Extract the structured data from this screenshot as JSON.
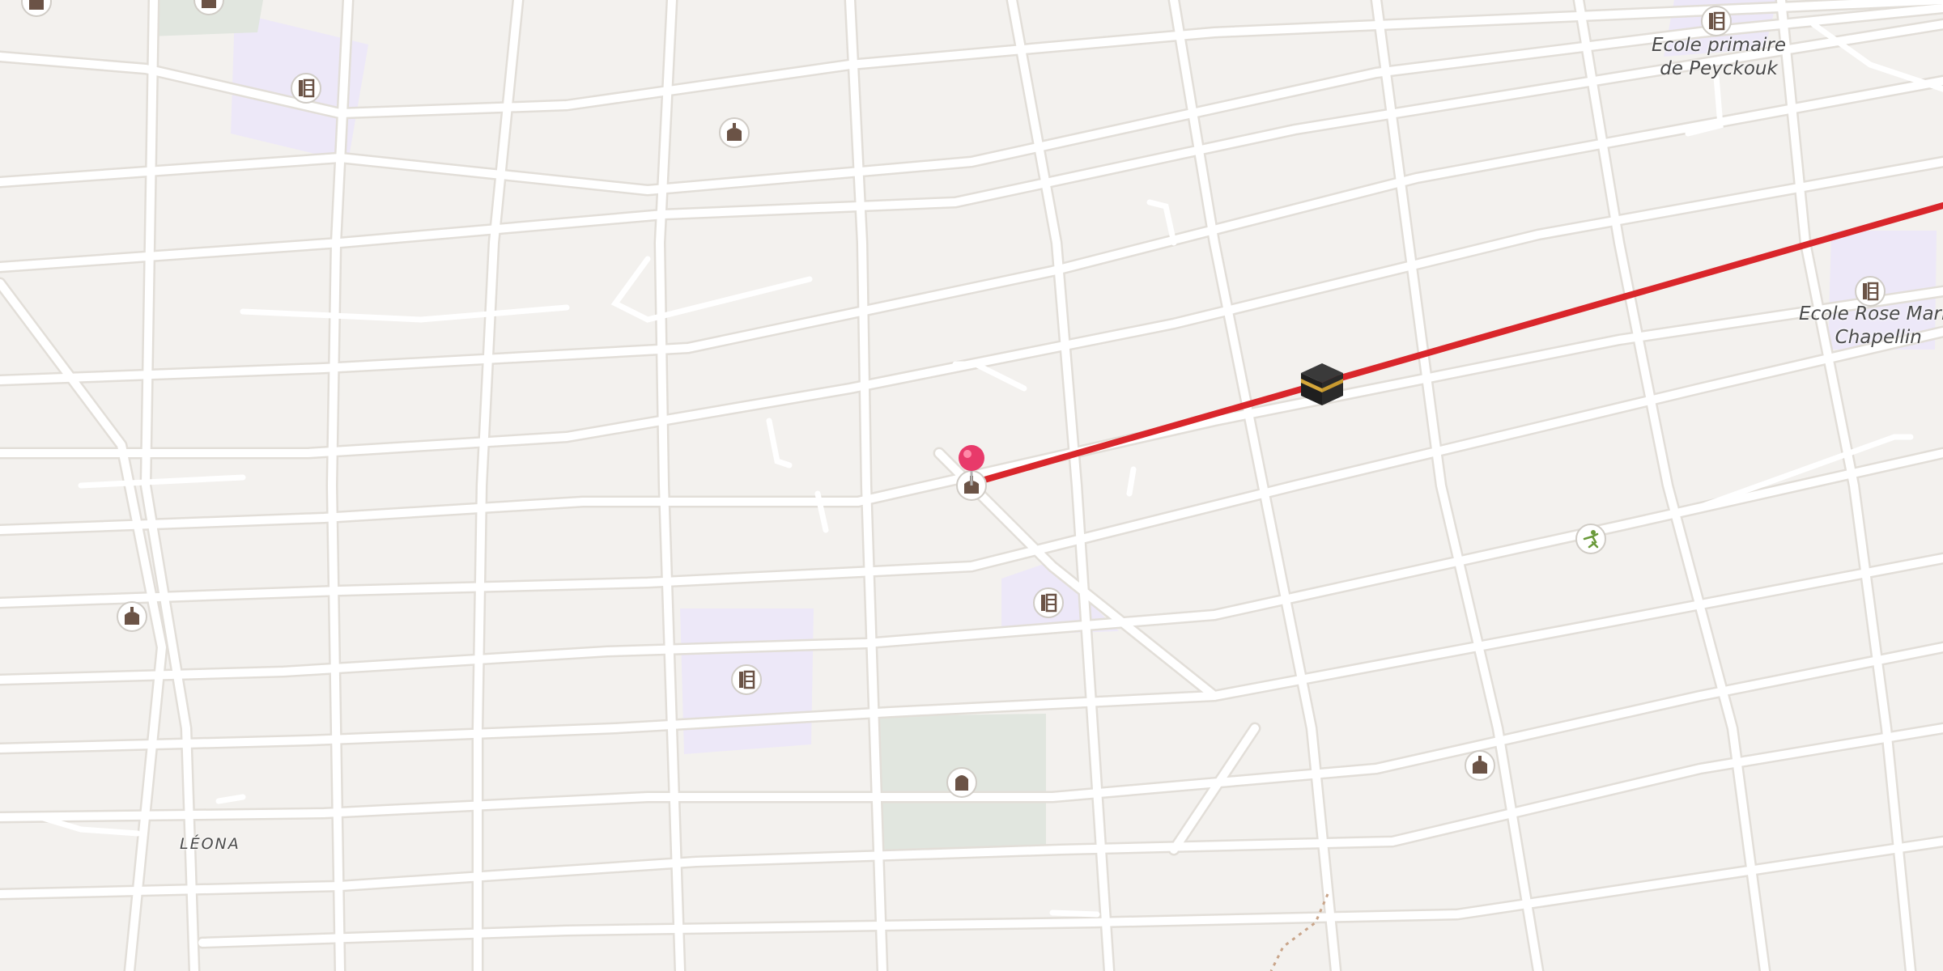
{
  "map": {
    "labels": {
      "school_peyckouk": {
        "line1": "Ecole primaire",
        "line2": "de Peyckouk"
      },
      "school_rose_marie": {
        "line1": "Ecole Rose Marie",
        "line2": "Chapellin"
      },
      "district": "LÉONA"
    },
    "colors": {
      "background": "#f3f1ee",
      "road": "#ffffff",
      "road_casing": "#e2ded8",
      "school_area": "#ede8f8",
      "cemetery_area": "#e1e6df",
      "route_line": "#d9262b",
      "pin": "#e83a6a",
      "poi_icon": "#6b5346",
      "sport_icon": "#6a9a3a"
    },
    "icons": {
      "school": "school-icon",
      "mosque": "mosque-icon",
      "cemetery": "cemetery-icon",
      "sport": "sport-icon",
      "kaaba": "kaaba-icon",
      "pin": "location-pin-icon",
      "qibla": "qibla-direction-line"
    }
  }
}
